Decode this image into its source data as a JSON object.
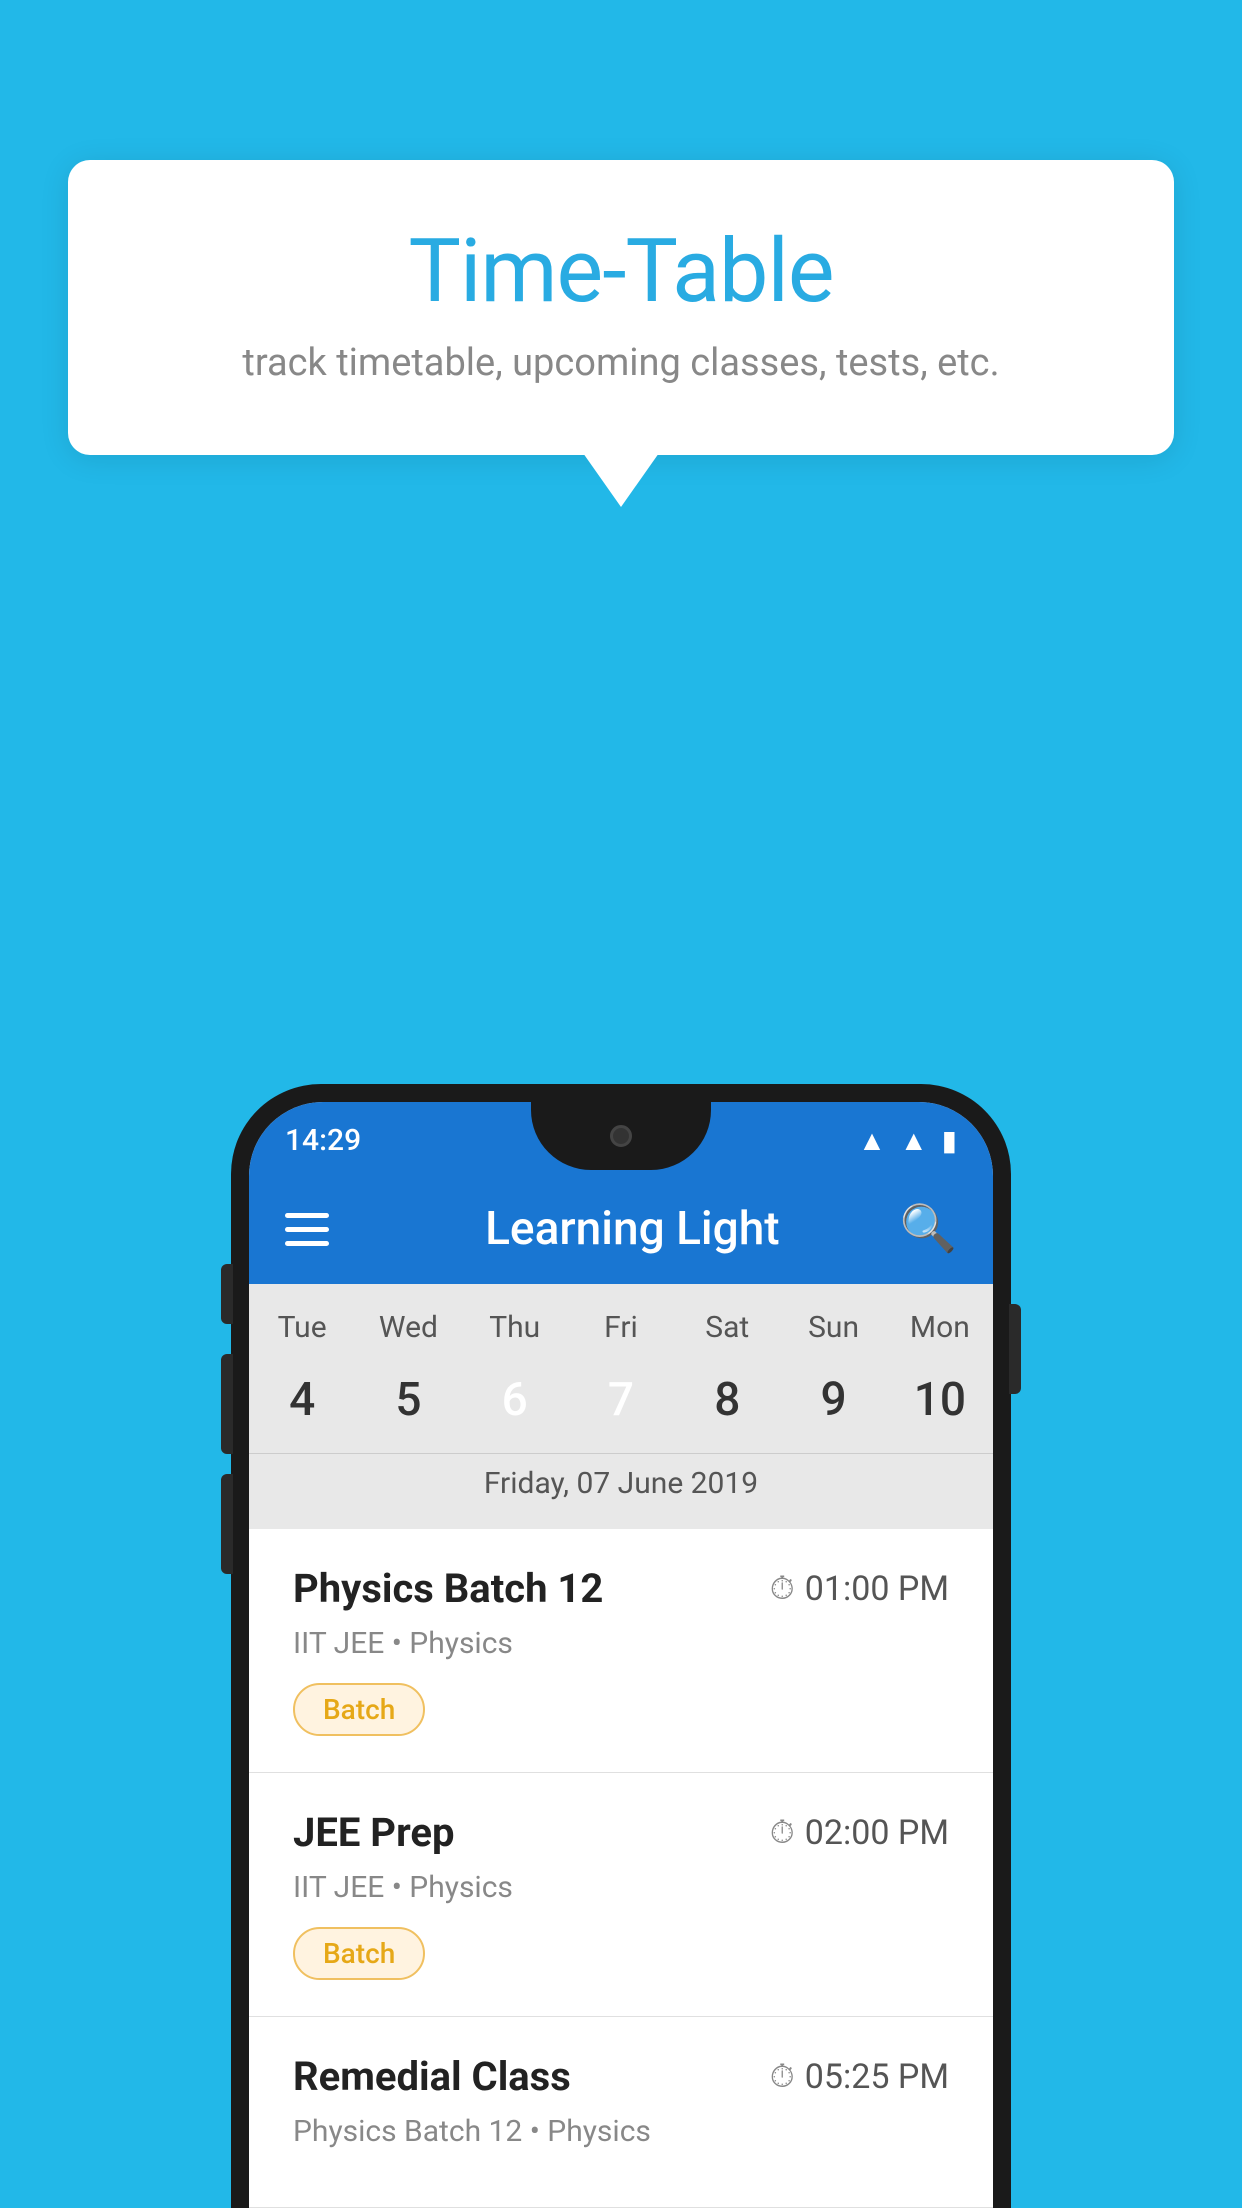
{
  "background_color": "#22b8e8",
  "bubble": {
    "title": "Time-Table",
    "subtitle": "track timetable, upcoming classes, tests, etc."
  },
  "phone": {
    "status_bar": {
      "time": "14:29",
      "icons": [
        "wifi",
        "signal",
        "battery"
      ]
    },
    "app_bar": {
      "title": "Learning Light"
    },
    "calendar": {
      "days": [
        {
          "short": "Tue",
          "num": "4"
        },
        {
          "short": "Wed",
          "num": "5"
        },
        {
          "short": "Thu",
          "num": "6",
          "state": "today"
        },
        {
          "short": "Fri",
          "num": "7",
          "state": "selected"
        },
        {
          "short": "Sat",
          "num": "8"
        },
        {
          "short": "Sun",
          "num": "9"
        },
        {
          "short": "Mon",
          "num": "10"
        }
      ],
      "selected_date_label": "Friday, 07 June 2019"
    },
    "schedule": [
      {
        "title": "Physics Batch 12",
        "time": "01:00 PM",
        "subtitle": "IIT JEE • Physics",
        "tag": "Batch"
      },
      {
        "title": "JEE Prep",
        "time": "02:00 PM",
        "subtitle": "IIT JEE • Physics",
        "tag": "Batch"
      },
      {
        "title": "Remedial Class",
        "time": "05:25 PM",
        "subtitle": "Physics Batch 12 • Physics",
        "tag": ""
      }
    ]
  }
}
